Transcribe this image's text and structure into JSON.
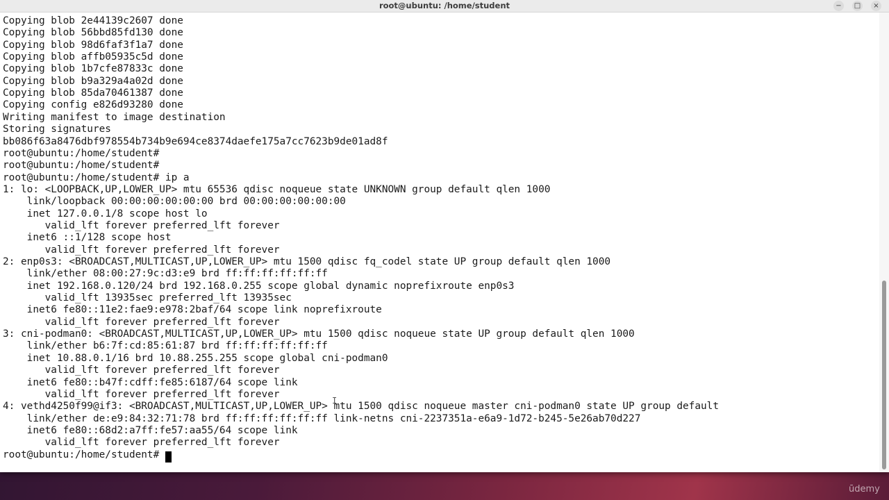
{
  "window": {
    "title": "root@ubuntu: /home/student",
    "minimize_glyph": "−",
    "maximize_glyph": "□",
    "close_glyph": "×"
  },
  "terminal": {
    "lines": [
      "Copying blob 2e44139c2607 done",
      "Copying blob 56bbd85fd130 done",
      "Copying blob 98d6faf3f1a7 done",
      "Copying blob affb05935c5d done",
      "Copying blob 1b7cfe87833c done",
      "Copying blob b9a329a4a02d done",
      "Copying blob 85da70461387 done",
      "Copying config e826d93280 done",
      "Writing manifest to image destination",
      "Storing signatures",
      "bb086f63a8476dbf978554b734b9e694ce8374daefe175a7cc7623b9de01ad8f",
      "root@ubuntu:/home/student#",
      "root@ubuntu:/home/student#",
      "root@ubuntu:/home/student# ip a",
      "1: lo: <LOOPBACK,UP,LOWER_UP> mtu 65536 qdisc noqueue state UNKNOWN group default qlen 1000",
      "    link/loopback 00:00:00:00:00:00 brd 00:00:00:00:00:00",
      "    inet 127.0.0.1/8 scope host lo",
      "       valid_lft forever preferred_lft forever",
      "    inet6 ::1/128 scope host",
      "       valid_lft forever preferred_lft forever",
      "2: enp0s3: <BROADCAST,MULTICAST,UP,LOWER_UP> mtu 1500 qdisc fq_codel state UP group default qlen 1000",
      "    link/ether 08:00:27:9c:d3:e9 brd ff:ff:ff:ff:ff:ff",
      "    inet 192.168.0.120/24 brd 192.168.0.255 scope global dynamic noprefixroute enp0s3",
      "       valid_lft 13935sec preferred_lft 13935sec",
      "    inet6 fe80::11e2:fae9:e978:2baf/64 scope link noprefixroute",
      "       valid_lft forever preferred_lft forever",
      "3: cni-podman0: <BROADCAST,MULTICAST,UP,LOWER_UP> mtu 1500 qdisc noqueue state UP group default qlen 1000",
      "    link/ether b6:7f:cd:85:61:87 brd ff:ff:ff:ff:ff:ff",
      "    inet 10.88.0.1/16 brd 10.88.255.255 scope global cni-podman0",
      "       valid_lft forever preferred_lft forever",
      "    inet6 fe80::b47f:cdff:fe85:6187/64 scope link",
      "       valid_lft forever preferred_lft forever",
      "4: vethd4250f99@if3: <BROADCAST,MULTICAST,UP,LOWER_UP> mtu 1500 qdisc noqueue master cni-podman0 state UP group default",
      "    link/ether de:e9:84:32:71:78 brd ff:ff:ff:ff:ff:ff link-netns cni-2237351a-e6a9-1d72-b245-5e26ab70d227",
      "    inet6 fe80::68d2:a7ff:fe57:aa55/64 scope link",
      "       valid_lft forever preferred_lft forever",
      "root@ubuntu:/home/student# "
    ]
  },
  "overlay": {
    "text_cursor_glyph": "I",
    "watermark": "ūdemy"
  },
  "colors": {
    "terminal_background": "#ffffff",
    "terminal_text": "#1a1a1a",
    "titlebar": "#ebebeb",
    "desktop_accent": "#7a2640"
  }
}
